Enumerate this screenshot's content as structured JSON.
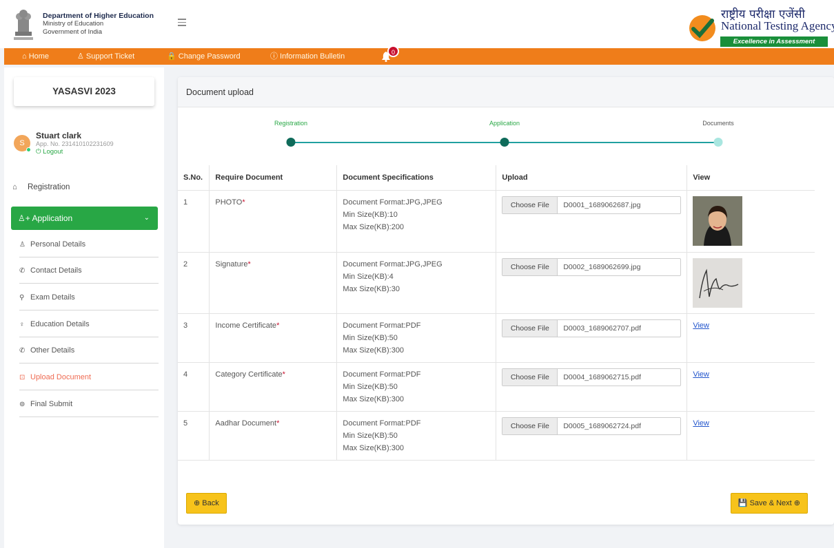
{
  "header": {
    "dept_line1": "Department of Higher Education",
    "dept_line2": "Ministry of Education",
    "dept_line3": "Government of India",
    "nta_hindi": "राष्ट्रीय परीक्षा एजेंसी",
    "nta_english": "National Testing Agency",
    "nta_tagline": "Excellence in Assessment"
  },
  "navbar": {
    "home": "⌂ Home",
    "support": "♙ Support Ticket",
    "change_password": "🔒 Change Password",
    "info_bulletin": "ⓘ Information Bulletin",
    "notification_count": "0"
  },
  "sidebar": {
    "program": "YASASVI 2023",
    "user_name": "Stuart clark",
    "app_no": "App. No. 231410102231609",
    "logout": "Logout",
    "avatar_letter": "S",
    "registration": "Registration",
    "application": "Application",
    "sub_items": [
      {
        "icon": "♙",
        "label": "Personal Details"
      },
      {
        "icon": "✆",
        "label": "Contact Details"
      },
      {
        "icon": "⚲",
        "label": "Exam Details"
      },
      {
        "icon": "♀",
        "label": "Education Details"
      },
      {
        "icon": "✆",
        "label": "Other Details"
      },
      {
        "icon": "⊡",
        "label": "Upload Document"
      },
      {
        "icon": "⊚",
        "label": "Final Submit"
      }
    ]
  },
  "main": {
    "title": "Document upload",
    "steps": [
      "Registration",
      "Application",
      "Documents"
    ],
    "columns": [
      "S.No.",
      "Require Document",
      "Document Specifications",
      "Upload",
      "View"
    ],
    "choose_label": "Choose File",
    "view_label": "View",
    "rows": [
      {
        "sno": "1",
        "doc": "PHOTO",
        "format": "Document Format:JPG,JPEG",
        "min": "Min Size(KB):10",
        "max": "Max Size(KB):200",
        "file": "D0001_1689062687.jpg",
        "view": "photo"
      },
      {
        "sno": "2",
        "doc": "Signature",
        "format": "Document Format:JPG,JPEG",
        "min": "Min Size(KB):4",
        "max": "Max Size(KB):30",
        "file": "D0002_1689062699.jpg",
        "view": "signature"
      },
      {
        "sno": "3",
        "doc": "Income Certificate",
        "format": "Document Format:PDF",
        "min": "Min Size(KB):50",
        "max": "Max Size(KB):300",
        "file": "D0003_1689062707.pdf",
        "view": "link"
      },
      {
        "sno": "4",
        "doc": "Category Certificate",
        "format": "Document Format:PDF",
        "min": "Min Size(KB):50",
        "max": "Max Size(KB):300",
        "file": "D0004_1689062715.pdf",
        "view": "link"
      },
      {
        "sno": "5",
        "doc": "Aadhar Document",
        "format": "Document Format:PDF",
        "min": "Min Size(KB):50",
        "max": "Max Size(KB):300",
        "file": "D0005_1689062724.pdf",
        "view": "link"
      }
    ],
    "back_button": "⊕ Back",
    "save_next_button": "💾 Save & Next ⊕"
  },
  "colors": {
    "accent_orange": "#ef7d1a",
    "green": "#28a745",
    "teal": "#20a0a0",
    "button_yellow": "#f7c31b"
  }
}
